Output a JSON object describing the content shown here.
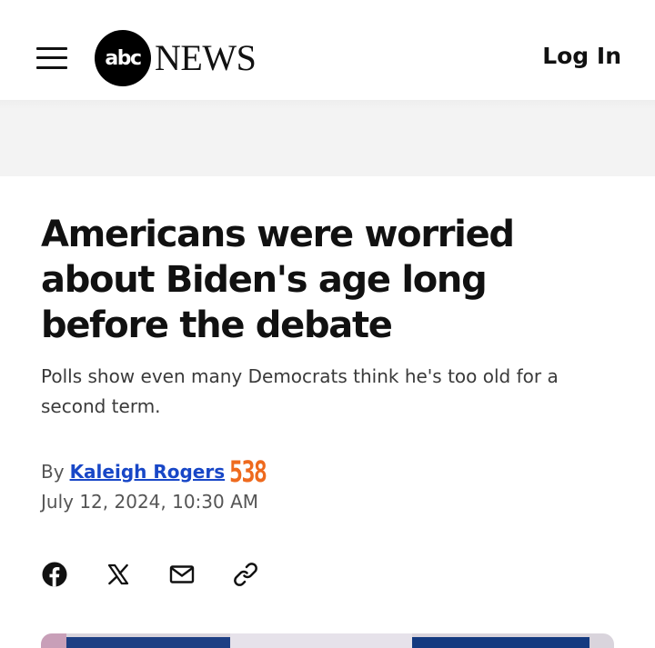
{
  "header": {
    "logo_circle_text": "abc",
    "logo_word": "NEWS",
    "login_label": "Log In"
  },
  "article": {
    "headline": "Americans were worried about Biden's age long before the debate",
    "subheadline": "Polls show even many Democrats think he's too old for a second term.",
    "byline_prefix": "By",
    "author": "Kaleigh Rogers",
    "outlet_badge": "538",
    "date": "July 12, 2024, 10:30 AM"
  },
  "share": {
    "icons": [
      "facebook-icon",
      "x-icon",
      "email-icon",
      "link-icon"
    ]
  },
  "colors": {
    "author_link": "#1847c7",
    "badge_538": "#ee6a1e",
    "text_primary": "#111111",
    "ad_band": "#f3f3f3"
  }
}
